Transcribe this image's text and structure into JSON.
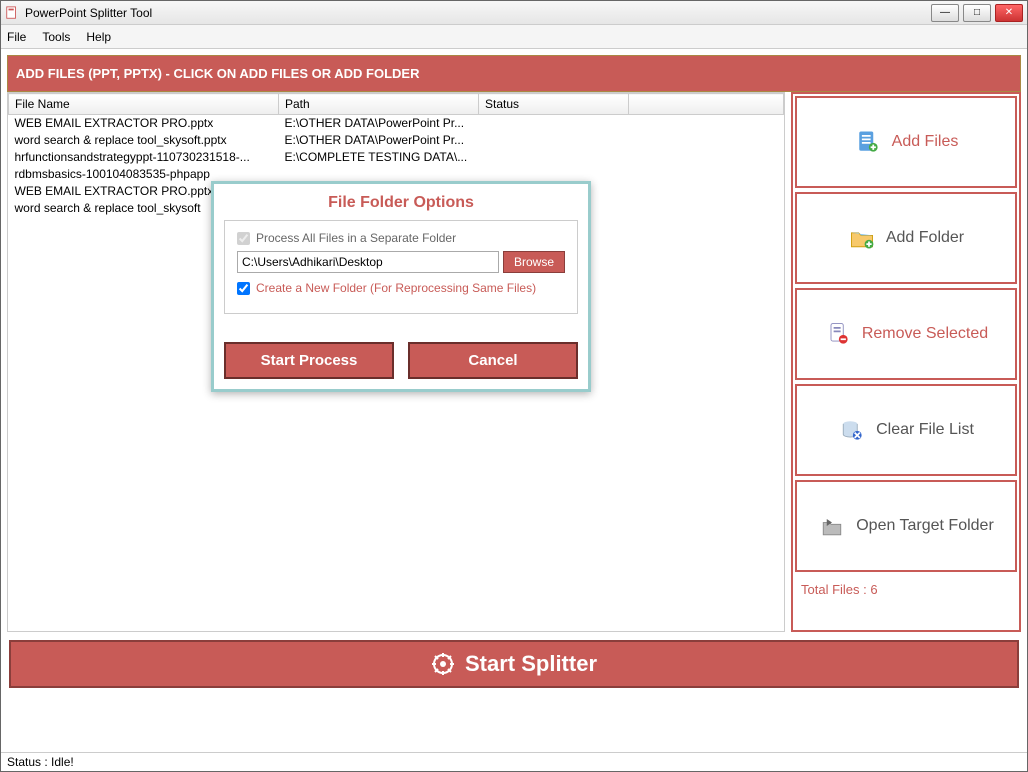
{
  "window": {
    "title": "PowerPoint Splitter Tool"
  },
  "menu": {
    "file": "File",
    "tools": "Tools",
    "help": "Help"
  },
  "banner": "ADD FILES (PPT, PPTX) - CLICK ON ADD FILES OR ADD FOLDER",
  "columns": {
    "file": "File Name",
    "path": "Path",
    "status": "Status"
  },
  "rows": [
    {
      "file": "WEB EMAIL EXTRACTOR PRO.pptx",
      "path": "E:\\OTHER DATA\\PowerPoint Pr...",
      "status": ""
    },
    {
      "file": "word search & replace tool_skysoft.pptx",
      "path": "E:\\OTHER DATA\\PowerPoint Pr...",
      "status": ""
    },
    {
      "file": "hrfunctionsandstrategyppt-110730231518-...",
      "path": "E:\\COMPLETE TESTING DATA\\...",
      "status": ""
    },
    {
      "file": "rdbmsbasics-100104083535-phpapp",
      "path": "",
      "status": ""
    },
    {
      "file": "WEB EMAIL EXTRACTOR PRO.pptx",
      "path": "",
      "status": ""
    },
    {
      "file": "word search & replace tool_skysoft",
      "path": "",
      "status": ""
    }
  ],
  "side": {
    "add_files": "Add Files",
    "add_folder": "Add Folder",
    "remove_selected": "Remove Selected",
    "clear_list": "Clear File List",
    "open_target": "Open Target Folder",
    "total": "Total Files : 6"
  },
  "start_button": "Start Splitter",
  "statusbar": "Status  :  Idle!",
  "dialog": {
    "title": "File Folder Options",
    "opt_process_all": "Process All Files in a Separate Folder",
    "path_value": "C:\\Users\\Adhikari\\Desktop",
    "browse": "Browse",
    "opt_new_folder": "Create a New Folder (For Reprocessing Same Files)",
    "start": "Start Process",
    "cancel": "Cancel"
  }
}
